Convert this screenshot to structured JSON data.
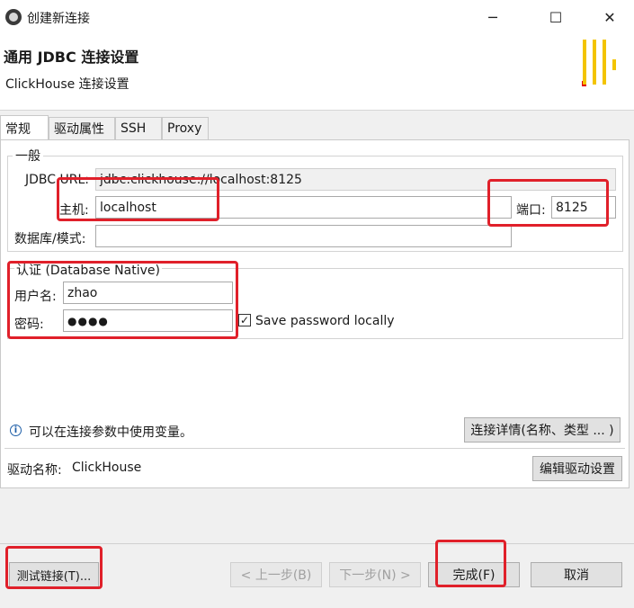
{
  "window": {
    "title": "创建新连接",
    "controls": {
      "minimize": "─",
      "maximize": "☐",
      "close": "✕"
    }
  },
  "header": {
    "title": "通用 JDBC 连接设置",
    "subtitle": "ClickHouse 连接设置"
  },
  "tabs": [
    {
      "label": "常规",
      "active": true
    },
    {
      "label": "驱动属性",
      "active": false
    },
    {
      "label": "SSH",
      "active": false
    },
    {
      "label": "Proxy",
      "active": false
    }
  ],
  "general": {
    "group_label": "一般",
    "jdbc_url_label": "JDBC URL:",
    "jdbc_url_value": "jdbc:clickhouse://localhost:8125",
    "host_label": "主机:",
    "host_value": "localhost",
    "port_label": "端口:",
    "port_value": "8125",
    "database_label": "数据库/模式:",
    "database_value": ""
  },
  "auth": {
    "group_label": "认证 (Database Native)",
    "username_label": "用户名:",
    "username_value": "zhao",
    "password_label": "密码:",
    "password_value": "●●●●",
    "save_password_label": "Save password locally",
    "save_password_checked": true,
    "check_glyph": "✓"
  },
  "info": {
    "icon_glyph": "i",
    "text": "可以在连接参数中使用变量。",
    "details_button": "连接详情(名称、类型 ... )"
  },
  "driver": {
    "name_label": "驱动名称:",
    "name_value": "ClickHouse",
    "edit_button": "编辑驱动设置"
  },
  "footer": {
    "test_button": "测试链接(T)...",
    "back_button": "< 上一步(B)",
    "next_button": "下一步(N) >",
    "finish_button": "完成(F)",
    "cancel_button": "取消"
  },
  "colors": {
    "highlight": "#e0202a",
    "logo_yellow": "#f3c400",
    "logo_red": "#e3000f"
  }
}
